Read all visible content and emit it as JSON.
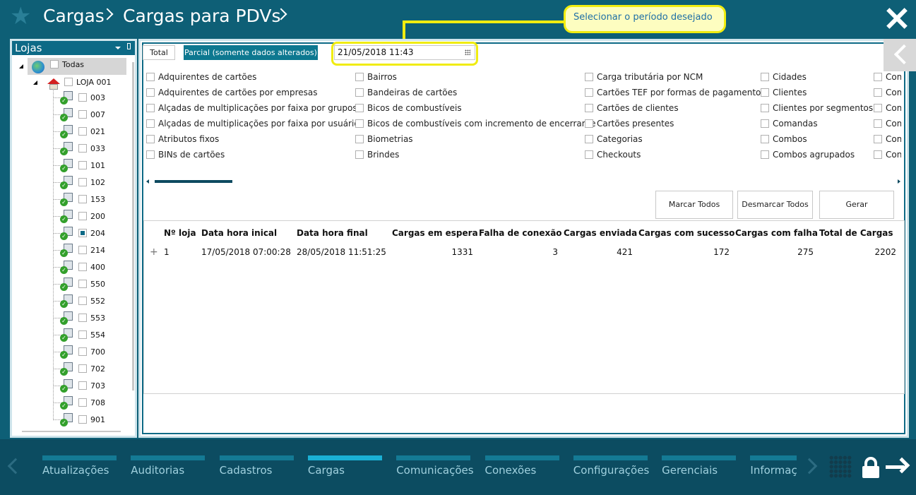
{
  "header": {
    "breadcrumb": [
      "Cargas",
      "Cargas para PDVs"
    ],
    "hint_text": "Selecionar o período desejado"
  },
  "left_panel": {
    "title": "Lojas",
    "root_label": "Todas",
    "store_label": "LOJA 001",
    "pdvs": [
      "003",
      "007",
      "021",
      "033",
      "101",
      "102",
      "153",
      "200",
      "204",
      "214",
      "400",
      "550",
      "552",
      "553",
      "554",
      "700",
      "702",
      "703",
      "708",
      "901"
    ],
    "checked_pdv": "204"
  },
  "tabs": {
    "total": "Total",
    "parcial": "Parcial (somente dados alterados)"
  },
  "date_value": "21/05/2018 11:43",
  "options": {
    "col1": [
      "Adquirentes de cartões",
      "Adquirentes de cartões por empresas",
      "Alçadas de multiplicações por faixa por grupos",
      "Alçadas de multiplicações por faixa por usuários",
      "Atributos fixos",
      "BINs de cartões"
    ],
    "col2": [
      "Bairros",
      "Bandeiras de cartões",
      "Bicos de combustíveis",
      "Bicos de combustíveis com incremento de encerrante",
      "Biometrias",
      "Brindes"
    ],
    "col3": [
      "Carga tributária por NCM",
      "Cartões TEF por formas de pagamentos",
      "Cartões de clientes",
      "Cartões presentes",
      "Categorias",
      "Checkouts"
    ],
    "col4": [
      "Cidades",
      "Clientes",
      "Clientes por segmentos",
      "Comandas",
      "Combos",
      "Combos agrupados"
    ],
    "col5": [
      "Com",
      "Com",
      "Com",
      "Com",
      "Com",
      "Conc"
    ]
  },
  "buttons": {
    "mark_all": "Marcar Todos",
    "unmark_all": "Desmarcar Todos",
    "generate": "Gerar"
  },
  "table": {
    "headers": [
      "Nº loja",
      "Data hora inical",
      "Data hora final",
      "Cargas em espera",
      "Falha de conexão",
      "Cargas enviada",
      "Cargas com sucesso",
      "Cargas com falha",
      "Total de Cargas"
    ],
    "rows": [
      [
        "1",
        "17/05/2018 07:00:28",
        "28/05/2018 11:51:25",
        "1331",
        "3",
        "421",
        "172",
        "275",
        "2202"
      ]
    ]
  },
  "nav": {
    "items": [
      "Atualizações",
      "Auditorias",
      "Cadastros",
      "Cargas",
      "Comunicações",
      "Conexões",
      "Configurações",
      "Gerenciais",
      "Informaç"
    ],
    "active": "Cargas"
  },
  "colors": {
    "background": "#0e5f76",
    "accent": "#0d7890",
    "highlight": "#f0ec10",
    "nav_bar": "#0c4c61"
  }
}
